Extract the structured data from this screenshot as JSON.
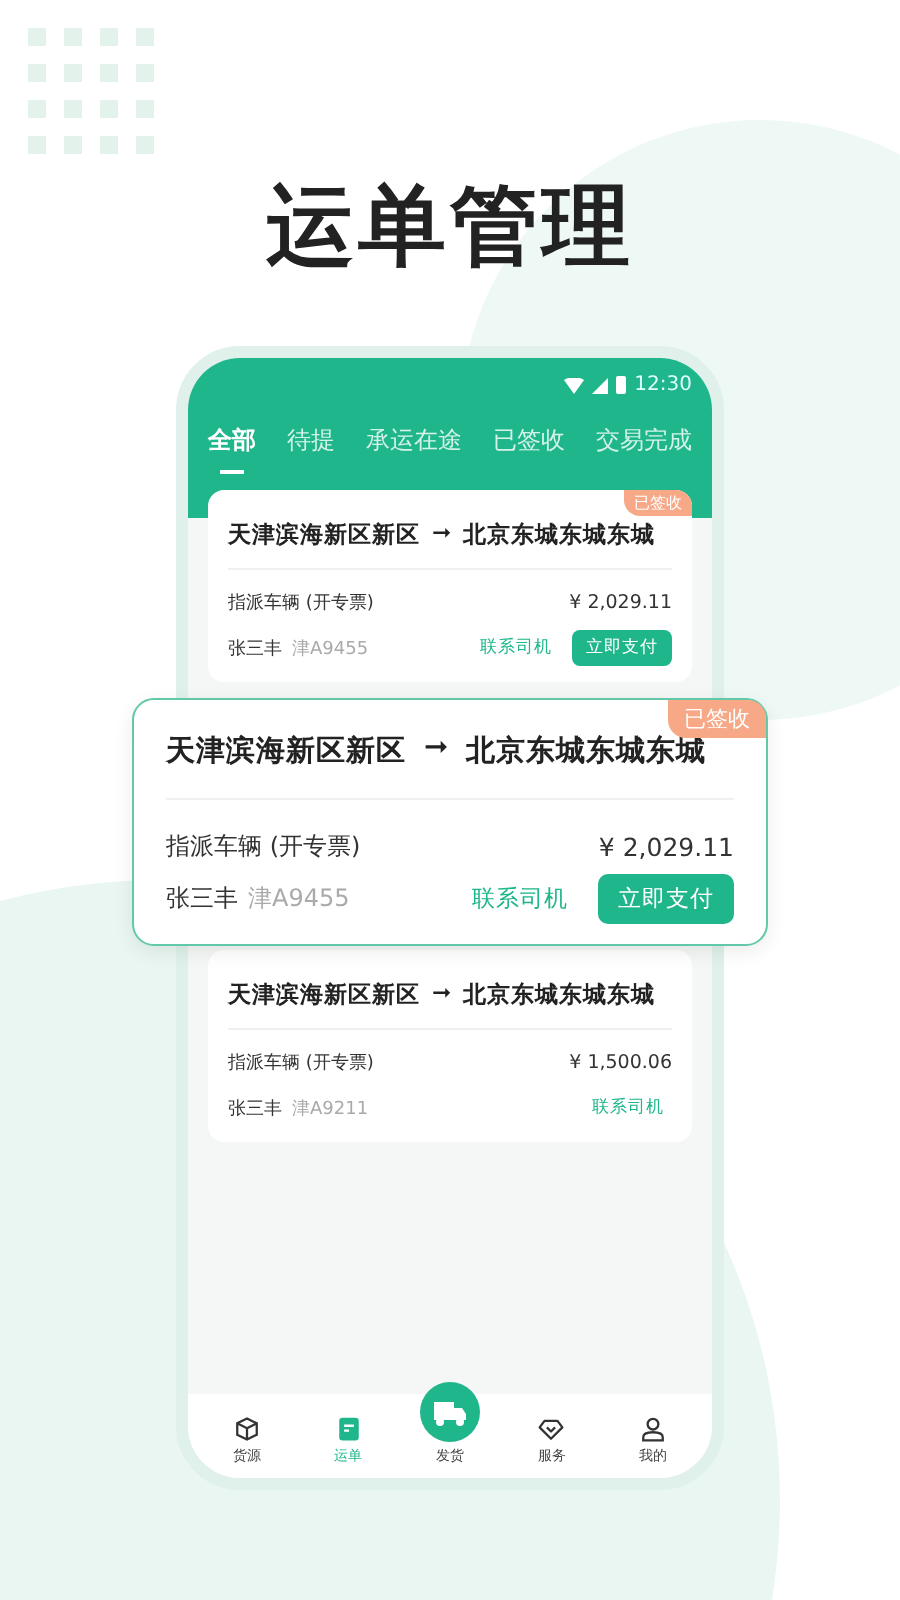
{
  "title": "运单管理",
  "status_bar": {
    "time": "12:30"
  },
  "tabs": [
    {
      "label": "全部",
      "selected": true
    },
    {
      "label": "待提",
      "selected": false
    },
    {
      "label": "承运在途",
      "selected": false
    },
    {
      "label": "已签收",
      "selected": false
    },
    {
      "label": "交易完成",
      "selected": false
    }
  ],
  "orders": [
    {
      "from": "天津滨海新区新区",
      "arrow": "➞",
      "to": "北京东城东城东城",
      "badge": "已签收",
      "vehicle": "指派车辆 (开专票)",
      "price": "¥ 2,029.11",
      "driver": "张三丰",
      "plate": "津A9455",
      "buttons": [
        {
          "label": "联系司机",
          "kind": "outline"
        },
        {
          "label": "立即支付",
          "kind": "primary"
        }
      ]
    },
    {
      "from": "天津滨海新区新区",
      "arrow": "➞",
      "to": "北京东城东城东城",
      "vehicle": "指派车辆 (开专票)",
      "price": "¥ 1,500.06",
      "driver": "张三丰",
      "plate": "津A9211",
      "buttons": [
        {
          "label": "联系司机",
          "kind": "outline"
        }
      ]
    }
  ],
  "featured_order": {
    "from": "天津滨海新区新区",
    "arrow": "➞",
    "to": "北京东城东城东城",
    "badge": "已签收",
    "vehicle": "指派车辆 (开专票)",
    "price": "¥ 2,029.11",
    "driver": "张三丰",
    "plate": "津A9455",
    "buttons": [
      {
        "label": "联系司机",
        "kind": "outline"
      },
      {
        "label": "立即支付",
        "kind": "primary"
      }
    ]
  },
  "nav": [
    {
      "label": "货源",
      "kind": "box",
      "selected": false
    },
    {
      "label": "运单",
      "kind": "doc",
      "selected": true
    },
    {
      "label": "发货",
      "kind": "truck",
      "selected": false
    },
    {
      "label": "服务",
      "kind": "diamond",
      "selected": false
    },
    {
      "label": "我的",
      "kind": "person",
      "selected": false
    }
  ]
}
